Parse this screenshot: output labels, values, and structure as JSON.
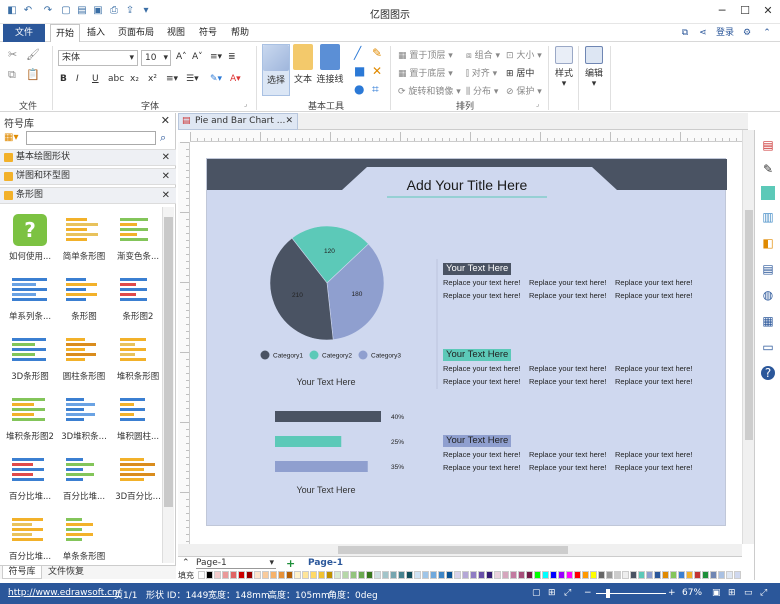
{
  "app": {
    "title": "亿图图示"
  },
  "menu": {
    "file": "文件",
    "items": [
      "开始",
      "插入",
      "页面布局",
      "视图",
      "符号",
      "帮助"
    ],
    "login": "登录"
  },
  "ribbon": {
    "font_name": "宋体",
    "font_size": "10",
    "groups": {
      "file": "文件",
      "font": "字体",
      "basic_tools": "基本工具",
      "arrange": "排列"
    },
    "tools": {
      "select": "选择",
      "text": "文本",
      "connector": "连接线",
      "style": "样式",
      "edit": "编辑"
    },
    "arrange": {
      "top": "置于顶层",
      "bottom": "置于底层",
      "rotate": "旋转和镜像",
      "group": "组合",
      "align": "对齐",
      "distribute": "分布",
      "size": "大小",
      "center": "居中",
      "protect": "保护"
    }
  },
  "left_panel": {
    "title": "符号库",
    "categories": [
      "基本绘图形状",
      "饼图和环型图",
      "条形图"
    ],
    "tiles": [
      "如何使用...",
      "简单条形图",
      "渐变色条...",
      "单系列条...",
      "条形图",
      "条形图2",
      "3D条形图",
      "圆柱条形图",
      "堆积条形图",
      "堆积条形图2",
      "3D堆积条...",
      "堆积圆柱...",
      "百分比堆...",
      "百分比堆...",
      "3D百分比...",
      "百分比堆...",
      "单条条形图"
    ],
    "tabs": [
      "符号库",
      "文件恢复"
    ]
  },
  "document": {
    "tab_name": "Pie and Bar Chart ...",
    "page_tab": "Page-1",
    "page_tab_active": "Page-1",
    "fill_label": "填充"
  },
  "canvas": {
    "title": "Add Your Title Here",
    "your_text": "Your Text Here",
    "section_title": "Your Text Here",
    "placeholder": "Replace your text here!",
    "section_colors": [
      "#4a5363",
      "#5cc9b8",
      "#8f9fcf"
    ]
  },
  "chart_data": [
    {
      "type": "pie",
      "categories": [
        "Category1",
        "Category2",
        "Category3"
      ],
      "values": [
        210,
        120,
        180
      ],
      "colors": [
        "#4a5363",
        "#5cc9b8",
        "#8f9fcf"
      ]
    },
    {
      "type": "bar",
      "orientation": "horizontal",
      "values": [
        40,
        25,
        35
      ],
      "labels": [
        "40%",
        "25%",
        "35%"
      ],
      "colors": [
        "#4a5363",
        "#5cc9b8",
        "#8f9fcf"
      ]
    }
  ],
  "status": {
    "url": "http://www.edrawsoft.cn/",
    "page": "页1/1",
    "shape_id": "形状 ID：1449",
    "width": "宽度：148mm",
    "height": "高度：105mm",
    "angle": "角度：0deg",
    "zoom": "67%"
  }
}
